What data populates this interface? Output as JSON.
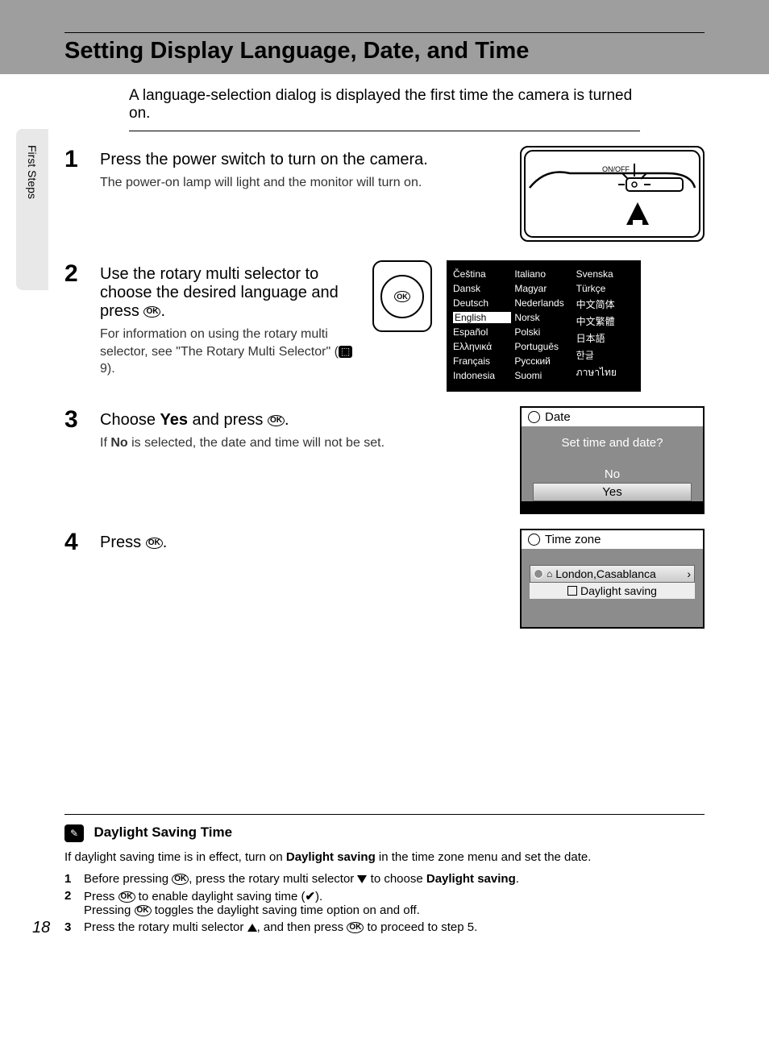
{
  "page": {
    "number": "18",
    "sideLabel": "First Steps",
    "title": "Setting Display Language, Date, and Time",
    "intro": "A language-selection dialog is displayed the first time the camera is turned on."
  },
  "steps": {
    "s1": {
      "num": "1",
      "title": "Press the power switch to turn on the camera.",
      "note": "The power-on lamp will light and the monitor will turn on.",
      "onoff": "ON/OFF"
    },
    "s2": {
      "num": "2",
      "titleA": "Use the rotary multi selector to choose the desired language and press ",
      "titleB": ".",
      "noteA": "For information on using the rotary multi selector, see \"The Rotary Multi Selector\" (",
      "noteB": " 9).",
      "ok": "OK",
      "languages": {
        "col1": [
          "Čeština",
          "Dansk",
          "Deutsch",
          "English",
          "Español",
          "Ελληνικά",
          "Français",
          "Indonesia"
        ],
        "col2": [
          "Italiano",
          "Magyar",
          "Nederlands",
          "Norsk",
          "Polski",
          "Português",
          "Русский",
          "Suomi"
        ],
        "col3": [
          "Svenska",
          "Türkçe",
          "中文简体",
          "中文繁體",
          "日本語",
          "한글",
          "ภาษาไทย",
          ""
        ]
      }
    },
    "s3": {
      "num": "3",
      "titleA": "Choose ",
      "titleBold": "Yes",
      "titleB": " and press ",
      "titleC": ".",
      "noteA": "If ",
      "noteBold": "No",
      "noteB": " is selected, the date and time will not be set.",
      "dlg": {
        "header": "Date",
        "prompt": "Set time and date?",
        "optNo": "No",
        "optYes": "Yes"
      }
    },
    "s4": {
      "num": "4",
      "titleA": "Press ",
      "titleB": ".",
      "dlg": {
        "header": "Time zone",
        "location": "London,Casablanca",
        "daylight": "Daylight saving"
      }
    }
  },
  "note": {
    "title": "Daylight Saving Time",
    "pA": "If daylight saving time is in effect, turn on ",
    "pBold": "Daylight saving",
    "pB": " in the time zone menu and set the date.",
    "l1": {
      "n": "1",
      "a": "Before pressing ",
      "b": ", press the rotary multi selector ",
      "c": " to choose ",
      "bold": "Daylight saving",
      "d": "."
    },
    "l2": {
      "n": "2",
      "a": "Press ",
      "b": " to enable daylight saving time (",
      "c": ").",
      "d": "Pressing ",
      "e": " toggles the daylight saving time option on and off."
    },
    "l3": {
      "n": "3",
      "a": "Press the rotary multi selector ",
      "b": ", and then press ",
      "c": " to proceed to step 5."
    }
  }
}
